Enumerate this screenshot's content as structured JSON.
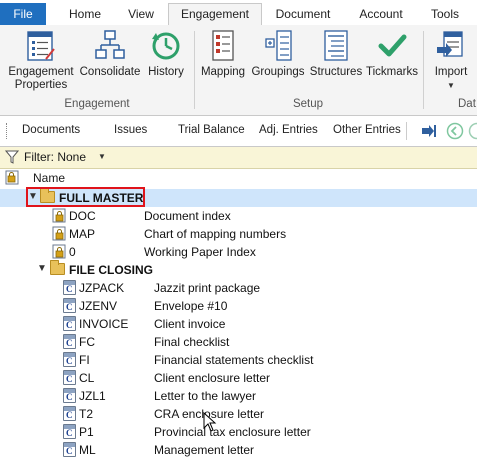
{
  "tabs": [
    {
      "label": "File"
    },
    {
      "label": "Home"
    },
    {
      "label": "View"
    },
    {
      "label": "Engagement"
    },
    {
      "label": "Document"
    },
    {
      "label": "Account"
    },
    {
      "label": "Tools"
    }
  ],
  "ribbon": {
    "engagement_group": {
      "label": "Engagement",
      "buttons": [
        {
          "label": "Engagement Properties",
          "line1": "Engagement",
          "line2": "Properties",
          "icon": "engagement-properties-icon"
        },
        {
          "label": "Consolidate",
          "icon": "consolidate-icon"
        },
        {
          "label": "History",
          "icon": "history-icon"
        }
      ]
    },
    "setup_group": {
      "label": "Setup",
      "buttons": [
        {
          "label": "Mapping",
          "icon": "mapping-icon"
        },
        {
          "label": "Groupings",
          "icon": "groupings-icon"
        },
        {
          "label": "Structures",
          "icon": "structures-icon"
        },
        {
          "label": "Tickmarks",
          "icon": "tickmarks-icon"
        }
      ]
    },
    "data_group": {
      "label": "Dat",
      "buttons": [
        {
          "label": "Import",
          "icon": "import-icon"
        }
      ]
    }
  },
  "navbar": {
    "items": [
      "Documents",
      "Issues",
      "Trial Balance",
      "Adj. Entries",
      "Other Entries"
    ]
  },
  "filter": {
    "label": "Filter: None"
  },
  "column_header": {
    "name": "Name"
  },
  "tree": {
    "root": {
      "label": "FULL MASTER",
      "expanded": true,
      "highlighted": true
    },
    "root_items": [
      {
        "code": "DOC",
        "desc": "Document index"
      },
      {
        "code": "MAP",
        "desc": "Chart of mapping numbers"
      },
      {
        "code": "0",
        "desc": "Working Paper Index"
      }
    ],
    "folder": {
      "label": "FILE CLOSING",
      "expanded": true
    },
    "folder_items": [
      {
        "code": "JZPACK",
        "desc": "Jazzit print package"
      },
      {
        "code": "JZENV",
        "desc": "Envelope #10"
      },
      {
        "code": "INVOICE",
        "desc": "Client invoice"
      },
      {
        "code": "FC",
        "desc": "Final checklist"
      },
      {
        "code": "FI",
        "desc": "Financial statements checklist"
      },
      {
        "code": "CL",
        "desc": "Client enclosure letter"
      },
      {
        "code": "JZL1",
        "desc": "Letter to the lawyer"
      },
      {
        "code": "T2",
        "desc": "CRA enclosure letter"
      },
      {
        "code": "P1",
        "desc": "Provincial tax enclosure letter"
      },
      {
        "code": "ML",
        "desc": "Management letter"
      }
    ]
  },
  "colors": {
    "file_tab": "#1f6fbf",
    "selection": "#cfe5fb",
    "highlight_box": "#e0141b",
    "filter_bg": "#f9f5d7",
    "check_green": "#2ea06a"
  }
}
